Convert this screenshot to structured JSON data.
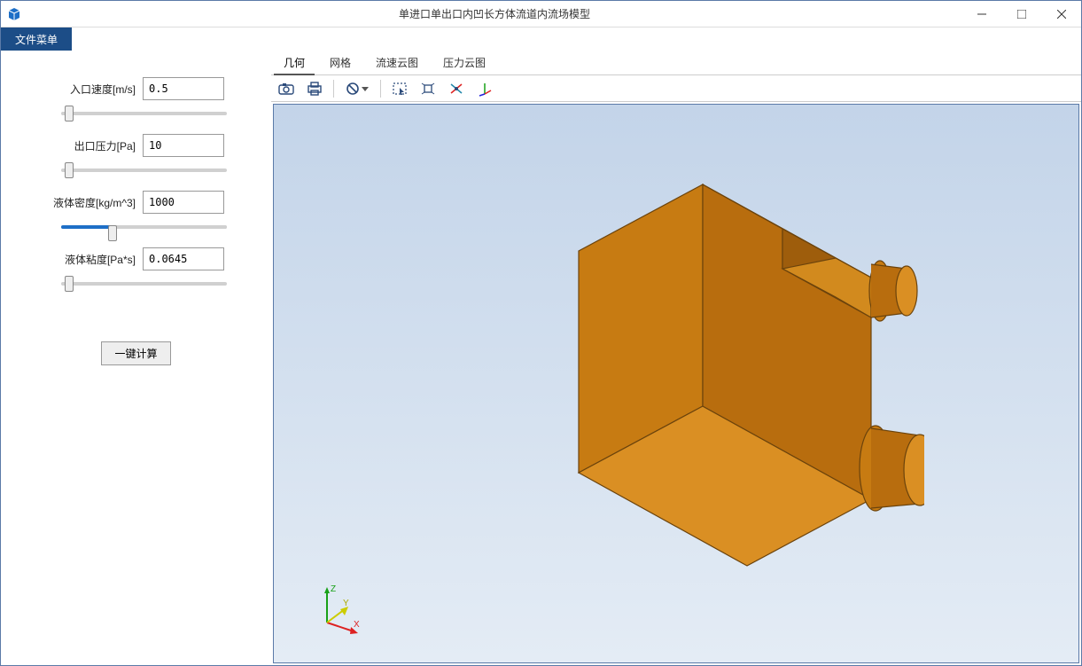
{
  "window": {
    "title": "单进口单出口内凹长方体流道内流场模型"
  },
  "menu": {
    "file": "文件菜单"
  },
  "params": {
    "inlet_velocity": {
      "label": "入口速度[m/s]",
      "value": "0.5"
    },
    "outlet_pressure": {
      "label": "出口压力[Pa]",
      "value": "10"
    },
    "density": {
      "label": "液体密度[kg/m^3]",
      "value": "1000"
    },
    "viscosity": {
      "label": "液体粘度[Pa*s]",
      "value": "0.0645"
    }
  },
  "buttons": {
    "calculate": "一键计算"
  },
  "tabs": [
    {
      "id": "geometry",
      "label": "几何",
      "active": true
    },
    {
      "id": "mesh",
      "label": "网格"
    },
    {
      "id": "velocity",
      "label": "流速云图"
    },
    {
      "id": "pressure",
      "label": "压力云图"
    }
  ],
  "toolbar_icons": {
    "camera": "camera-icon",
    "print": "print-icon",
    "refresh": "refresh-icon",
    "select": "select-box-icon",
    "fit": "fit-view-icon",
    "rotate": "rotate-icon",
    "axes": "axes-icon"
  },
  "axis_labels": {
    "x": "X",
    "y": "Y",
    "z": "Z"
  }
}
